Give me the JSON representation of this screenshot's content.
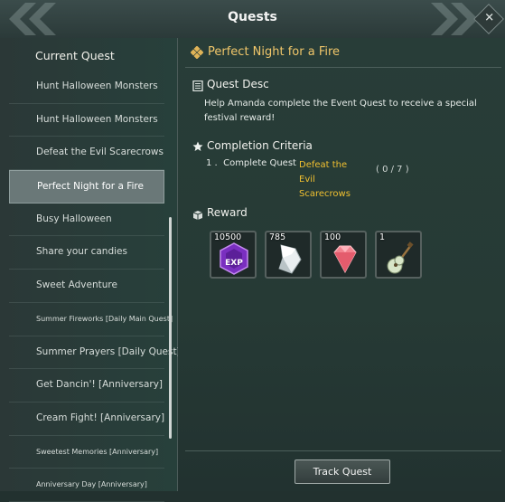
{
  "window": {
    "title": "Quests"
  },
  "left_panel": {
    "heading": "Current Quest",
    "quests": [
      {
        "label": "Hunt Halloween Monsters",
        "selected": false,
        "size": "normal"
      },
      {
        "label": "Hunt Halloween Monsters",
        "selected": false,
        "size": "normal"
      },
      {
        "label": "Defeat the Evil Scarecrows",
        "selected": false,
        "size": "normal"
      },
      {
        "label": "Perfect Night for a Fire",
        "selected": true,
        "size": "normal"
      },
      {
        "label": "Busy Halloween",
        "selected": false,
        "size": "normal"
      },
      {
        "label": "Share your candies",
        "selected": false,
        "size": "normal"
      },
      {
        "label": "Sweet Adventure",
        "selected": false,
        "size": "normal"
      },
      {
        "label": "Summer Fireworks [Daily Main Quest]",
        "selected": false,
        "size": "small"
      },
      {
        "label": "Summer Prayers [Daily Quest]",
        "selected": false,
        "size": "normal"
      },
      {
        "label": "Get Dancin'! [Anniversary]",
        "selected": false,
        "size": "normal"
      },
      {
        "label": "Cream Fight! [Anniversary]",
        "selected": false,
        "size": "normal"
      },
      {
        "label": "Sweetest Memories [Anniversary]",
        "selected": false,
        "size": "small"
      },
      {
        "label": "Anniversary Day [Anniversary]",
        "selected": false,
        "size": "small"
      }
    ]
  },
  "detail": {
    "quest_title": "Perfect Night for a Fire",
    "desc_heading": "Quest Desc",
    "desc_text": "Help Amanda complete the Event Quest to receive a special festival reward!",
    "criteria_heading": "Completion Criteria",
    "criteria": {
      "number": "1 .",
      "prefix": "Complete Quest",
      "target": "Defeat the Evil Scarecrows",
      "progress": "( 0 / 7 )"
    },
    "reward_heading": "Reward",
    "rewards": [
      {
        "count": "10500",
        "icon": "exp-crystal-icon"
      },
      {
        "count": "785",
        "icon": "silver-ore-icon"
      },
      {
        "count": "100",
        "icon": "pink-gem-icon"
      },
      {
        "count": "1",
        "icon": "guitar-icon"
      }
    ],
    "track_button": "Track Quest"
  },
  "colors": {
    "accent_gold": "#f0c66a",
    "link_yellow": "#f0c030",
    "panel_bg": "#263a35"
  }
}
